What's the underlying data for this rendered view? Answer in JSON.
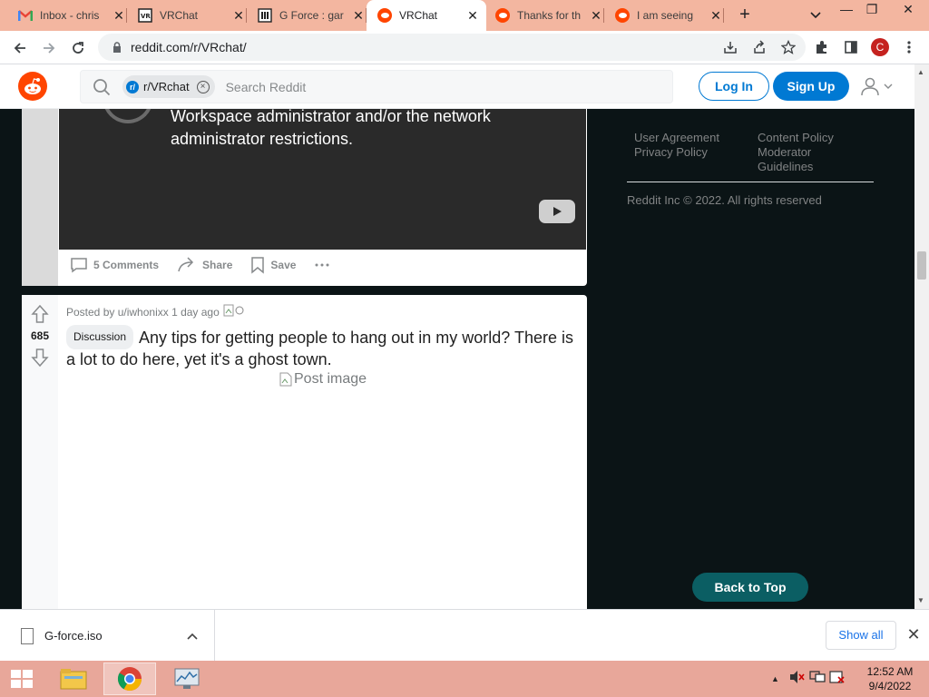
{
  "browser": {
    "tabs": [
      {
        "title": "Inbox - chris",
        "icon": "gmail-icon"
      },
      {
        "title": "VRChat",
        "icon": "vrchat-icon"
      },
      {
        "title": "G Force : gar",
        "icon": "museum-icon"
      },
      {
        "title": "VRChat",
        "icon": "reddit-icon",
        "active": true
      },
      {
        "title": "Thanks for th",
        "icon": "reddit-icon"
      },
      {
        "title": "I am seeing",
        "icon": "reddit-icon"
      }
    ],
    "url": "reddit.com/r/VRchat/",
    "profile_initial": "C"
  },
  "header": {
    "subreddit_chip": "r/VRchat",
    "search_placeholder": "Search Reddit",
    "login_label": "Log In",
    "signup_label": "Sign Up"
  },
  "post1": {
    "video_message": "Workspace administrator and/or the network administrator restrictions.",
    "comments_label": "5 Comments",
    "share_label": "Share",
    "save_label": "Save"
  },
  "post2": {
    "posted_by": "Posted by u/iwhonixx 1 day ago",
    "votes": "685",
    "flair": "Discussion",
    "title": "Any tips for getting people to hang out in my world? There is a lot to do here, yet it's a ghost town.",
    "image_alt": "Post image"
  },
  "sidebar": {
    "links_col1": [
      "User Agreement",
      "Privacy Policy"
    ],
    "links_col2": [
      "Content Policy",
      "Moderator",
      "Guidelines"
    ],
    "copyright": "Reddit Inc © 2022. All rights reserved",
    "back_to_top": "Back to Top"
  },
  "downloads": {
    "file_name": "G-force.iso",
    "show_all": "Show all"
  },
  "taskbar": {
    "time": "12:52 AM",
    "date": "9/4/2022"
  },
  "colors": {
    "reddit_orange": "#ff4500",
    "reddit_blue": "#0079d3",
    "back_to_top_bg": "#0b5e63",
    "tabstrip_bg": "#f3b6a0",
    "taskbar_bg": "#e8a79a"
  }
}
